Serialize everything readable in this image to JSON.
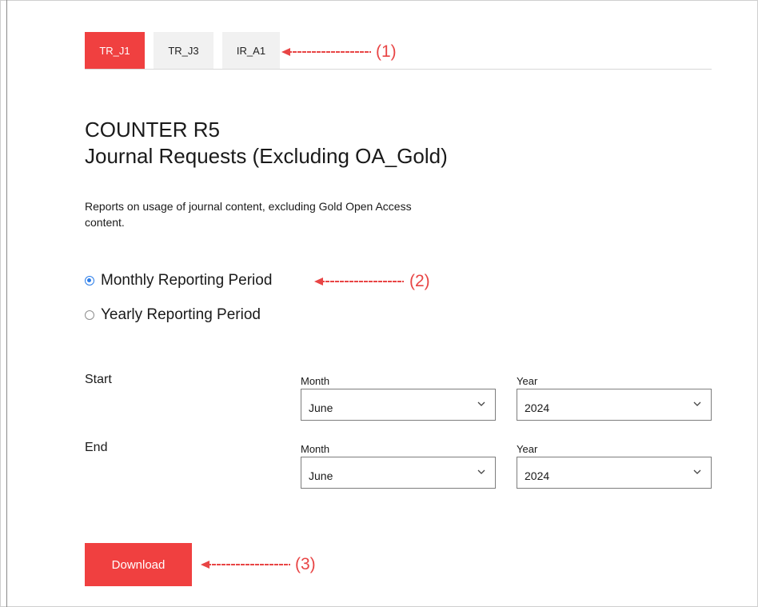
{
  "tabs": [
    {
      "label": "TR_J1",
      "active": true
    },
    {
      "label": "TR_J3",
      "active": false
    },
    {
      "label": "IR_A1",
      "active": false
    }
  ],
  "annotations": [
    "(1)",
    "(2)",
    "(3)"
  ],
  "report": {
    "title_line1": "COUNTER R5",
    "title_line2": "Journal Requests (Excluding OA_Gold)",
    "description": "Reports on usage of journal content, excluding Gold Open Access content."
  },
  "period": {
    "options": [
      {
        "label": "Monthly Reporting Period",
        "selected": true
      },
      {
        "label": "Yearly Reporting Period",
        "selected": false
      }
    ]
  },
  "range": {
    "month_label": "Month",
    "year_label": "Year",
    "start": {
      "label": "Start",
      "month": "June",
      "year": "2024"
    },
    "end": {
      "label": "End",
      "month": "June",
      "year": "2024"
    }
  },
  "download_label": "Download",
  "colors": {
    "accent": "#f04040",
    "annotation": "#e84545",
    "radio": "#2b7de9"
  }
}
